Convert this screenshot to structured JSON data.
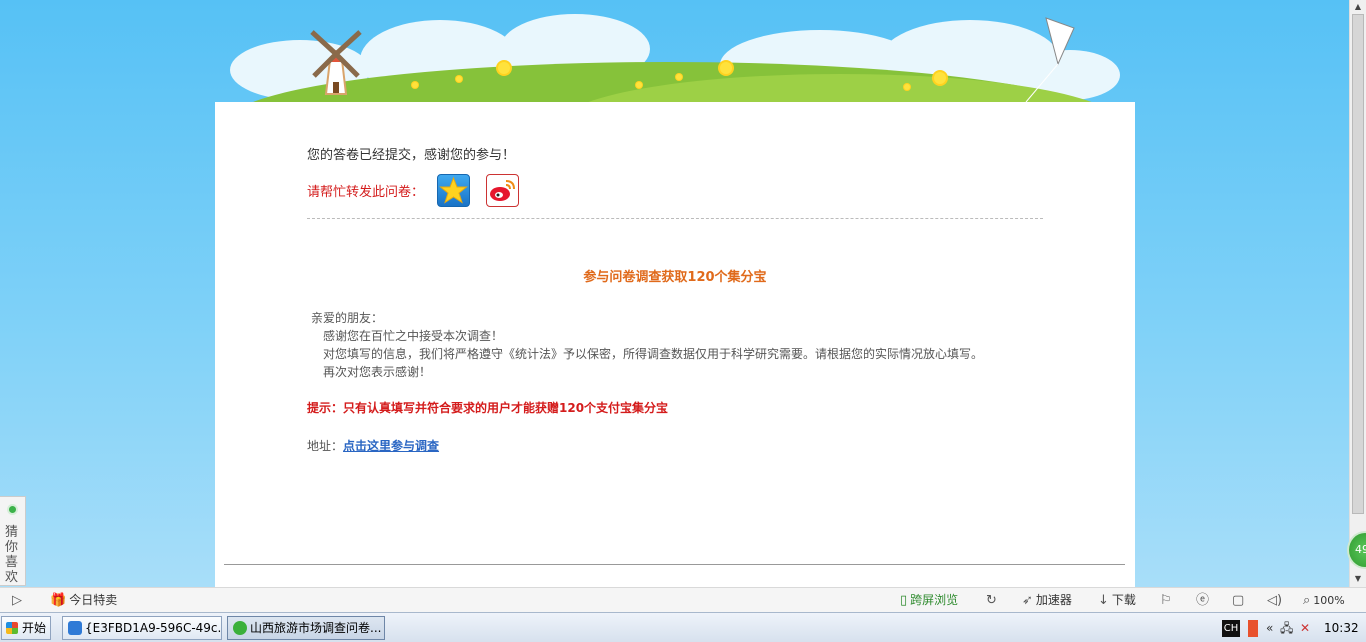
{
  "page": {
    "submitted_message": "您的答卷已经提交，感谢您的参与！",
    "share_label": "请帮忙转发此问卷：",
    "share_icons": [
      "qzone-icon",
      "weibo-icon"
    ],
    "survey_title": "参与问卷调查获取120个集分宝",
    "greeting": "亲爱的朋友：",
    "body_lines": [
      "感谢您在百忙之中接受本次调查！",
      "对您填写的信息，我们将严格遵守《统计法》予以保密，所得调查数据仅用于科学研究需要。请根据您的实际情况放心填写。",
      "再次对您表示感谢！"
    ],
    "tip": "提示：只有认真填写并符合要求的用户才能获赠120个支付宝集分宝",
    "address_label": "地址：",
    "address_link": "点击这里参与调查"
  },
  "side_widget": {
    "label": "猜你喜欢"
  },
  "badge": {
    "value": "49"
  },
  "statusbar": {
    "today_deals": "今日特卖",
    "cross_screen": "跨屏浏览",
    "accelerator": "加速器",
    "download": "下载",
    "zoom": "100%"
  },
  "taskbar": {
    "start": "开始",
    "tasks": [
      {
        "label": "{E3FBD1A9-596C-49c..."
      },
      {
        "label": "山西旅游市场调查问卷..."
      }
    ],
    "ime": "CH",
    "clock": "10:32"
  },
  "colors": {
    "accent_orange": "#e06a1b",
    "alert_red": "#d41c1c",
    "link_blue": "#2a66c3"
  }
}
